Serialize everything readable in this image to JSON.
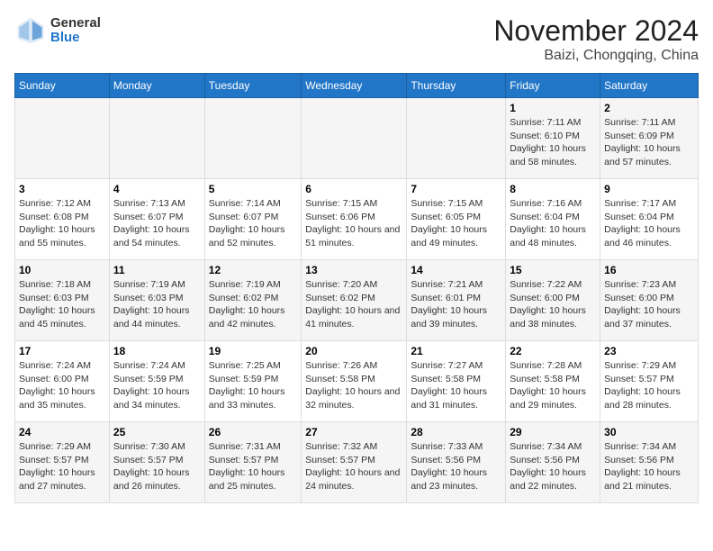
{
  "logo": {
    "general": "General",
    "blue": "Blue"
  },
  "title": "November 2024",
  "location": "Baizi, Chongqing, China",
  "days_of_week": [
    "Sunday",
    "Monday",
    "Tuesday",
    "Wednesday",
    "Thursday",
    "Friday",
    "Saturday"
  ],
  "weeks": [
    [
      {
        "day": "",
        "info": ""
      },
      {
        "day": "",
        "info": ""
      },
      {
        "day": "",
        "info": ""
      },
      {
        "day": "",
        "info": ""
      },
      {
        "day": "",
        "info": ""
      },
      {
        "day": "1",
        "info": "Sunrise: 7:11 AM\nSunset: 6:10 PM\nDaylight: 10 hours and 58 minutes."
      },
      {
        "day": "2",
        "info": "Sunrise: 7:11 AM\nSunset: 6:09 PM\nDaylight: 10 hours and 57 minutes."
      }
    ],
    [
      {
        "day": "3",
        "info": "Sunrise: 7:12 AM\nSunset: 6:08 PM\nDaylight: 10 hours and 55 minutes."
      },
      {
        "day": "4",
        "info": "Sunrise: 7:13 AM\nSunset: 6:07 PM\nDaylight: 10 hours and 54 minutes."
      },
      {
        "day": "5",
        "info": "Sunrise: 7:14 AM\nSunset: 6:07 PM\nDaylight: 10 hours and 52 minutes."
      },
      {
        "day": "6",
        "info": "Sunrise: 7:15 AM\nSunset: 6:06 PM\nDaylight: 10 hours and 51 minutes."
      },
      {
        "day": "7",
        "info": "Sunrise: 7:15 AM\nSunset: 6:05 PM\nDaylight: 10 hours and 49 minutes."
      },
      {
        "day": "8",
        "info": "Sunrise: 7:16 AM\nSunset: 6:04 PM\nDaylight: 10 hours and 48 minutes."
      },
      {
        "day": "9",
        "info": "Sunrise: 7:17 AM\nSunset: 6:04 PM\nDaylight: 10 hours and 46 minutes."
      }
    ],
    [
      {
        "day": "10",
        "info": "Sunrise: 7:18 AM\nSunset: 6:03 PM\nDaylight: 10 hours and 45 minutes."
      },
      {
        "day": "11",
        "info": "Sunrise: 7:19 AM\nSunset: 6:03 PM\nDaylight: 10 hours and 44 minutes."
      },
      {
        "day": "12",
        "info": "Sunrise: 7:19 AM\nSunset: 6:02 PM\nDaylight: 10 hours and 42 minutes."
      },
      {
        "day": "13",
        "info": "Sunrise: 7:20 AM\nSunset: 6:02 PM\nDaylight: 10 hours and 41 minutes."
      },
      {
        "day": "14",
        "info": "Sunrise: 7:21 AM\nSunset: 6:01 PM\nDaylight: 10 hours and 39 minutes."
      },
      {
        "day": "15",
        "info": "Sunrise: 7:22 AM\nSunset: 6:00 PM\nDaylight: 10 hours and 38 minutes."
      },
      {
        "day": "16",
        "info": "Sunrise: 7:23 AM\nSunset: 6:00 PM\nDaylight: 10 hours and 37 minutes."
      }
    ],
    [
      {
        "day": "17",
        "info": "Sunrise: 7:24 AM\nSunset: 6:00 PM\nDaylight: 10 hours and 35 minutes."
      },
      {
        "day": "18",
        "info": "Sunrise: 7:24 AM\nSunset: 5:59 PM\nDaylight: 10 hours and 34 minutes."
      },
      {
        "day": "19",
        "info": "Sunrise: 7:25 AM\nSunset: 5:59 PM\nDaylight: 10 hours and 33 minutes."
      },
      {
        "day": "20",
        "info": "Sunrise: 7:26 AM\nSunset: 5:58 PM\nDaylight: 10 hours and 32 minutes."
      },
      {
        "day": "21",
        "info": "Sunrise: 7:27 AM\nSunset: 5:58 PM\nDaylight: 10 hours and 31 minutes."
      },
      {
        "day": "22",
        "info": "Sunrise: 7:28 AM\nSunset: 5:58 PM\nDaylight: 10 hours and 29 minutes."
      },
      {
        "day": "23",
        "info": "Sunrise: 7:29 AM\nSunset: 5:57 PM\nDaylight: 10 hours and 28 minutes."
      }
    ],
    [
      {
        "day": "24",
        "info": "Sunrise: 7:29 AM\nSunset: 5:57 PM\nDaylight: 10 hours and 27 minutes."
      },
      {
        "day": "25",
        "info": "Sunrise: 7:30 AM\nSunset: 5:57 PM\nDaylight: 10 hours and 26 minutes."
      },
      {
        "day": "26",
        "info": "Sunrise: 7:31 AM\nSunset: 5:57 PM\nDaylight: 10 hours and 25 minutes."
      },
      {
        "day": "27",
        "info": "Sunrise: 7:32 AM\nSunset: 5:57 PM\nDaylight: 10 hours and 24 minutes."
      },
      {
        "day": "28",
        "info": "Sunrise: 7:33 AM\nSunset: 5:56 PM\nDaylight: 10 hours and 23 minutes."
      },
      {
        "day": "29",
        "info": "Sunrise: 7:34 AM\nSunset: 5:56 PM\nDaylight: 10 hours and 22 minutes."
      },
      {
        "day": "30",
        "info": "Sunrise: 7:34 AM\nSunset: 5:56 PM\nDaylight: 10 hours and 21 minutes."
      }
    ]
  ]
}
